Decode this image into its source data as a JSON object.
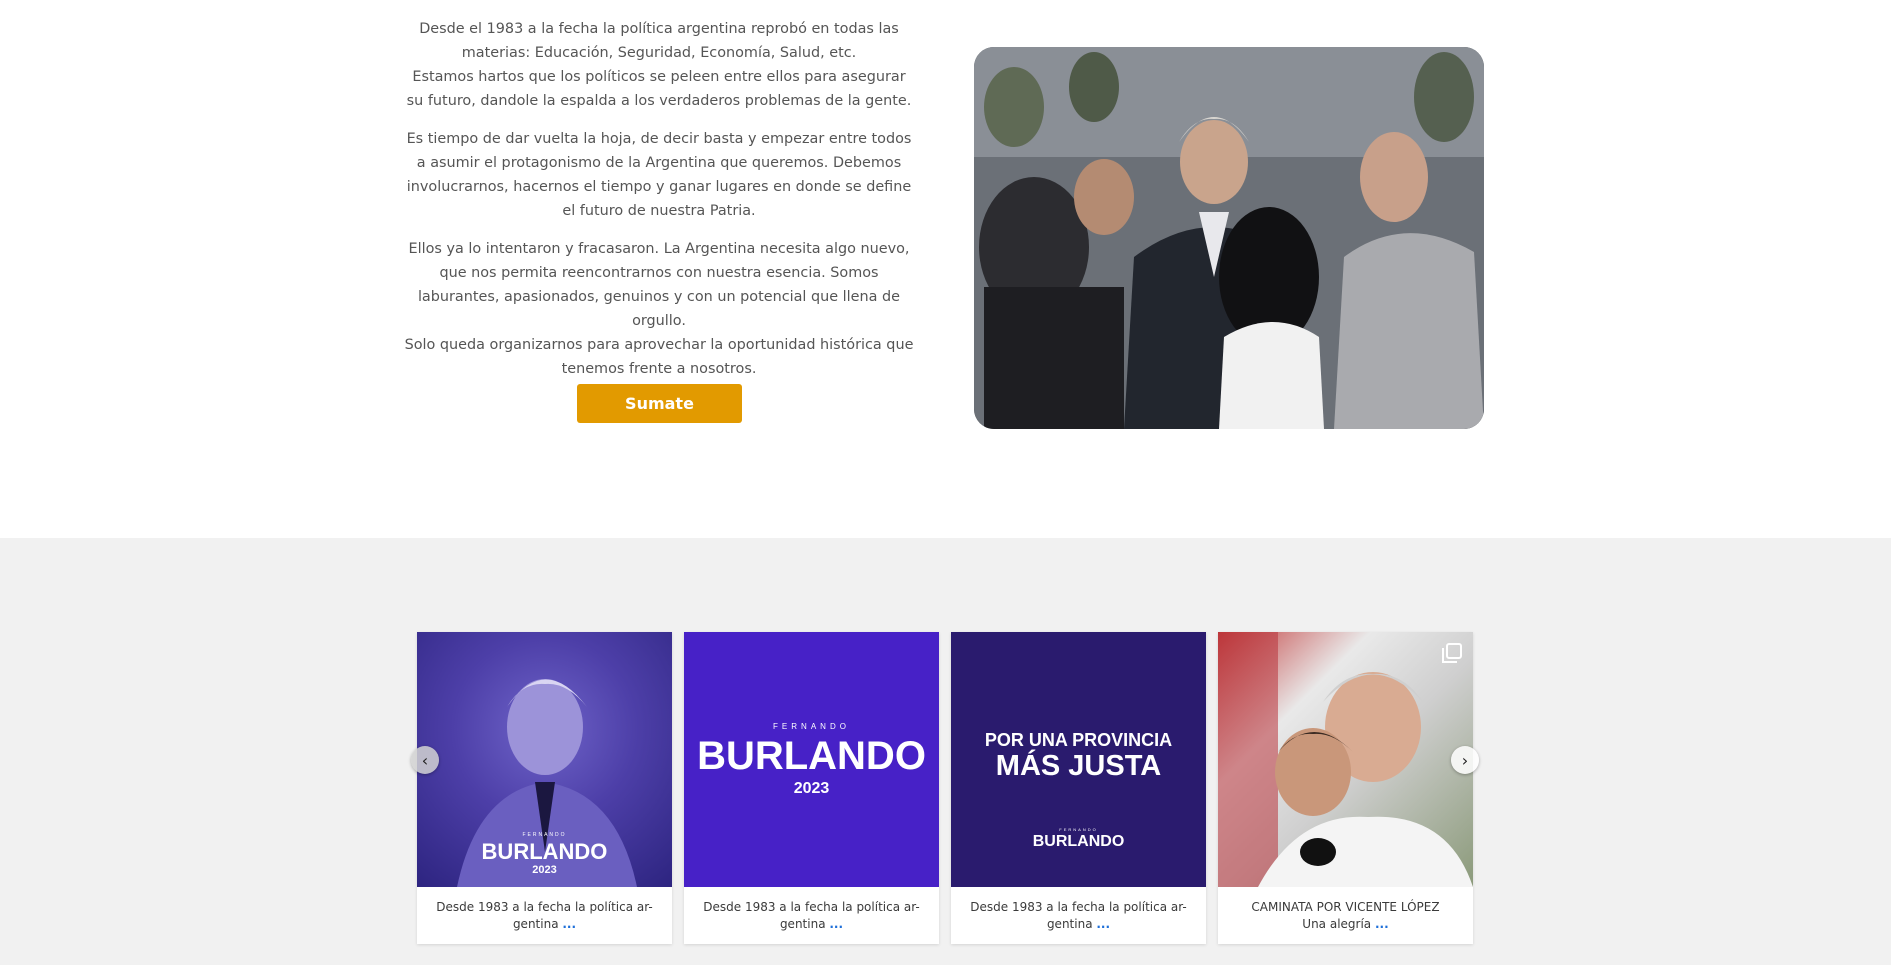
{
  "intro": {
    "paragraphs": [
      "Desde el 1983 a la fecha la política argentina reprobó en todas las materias: Educación, Seguridad, Economía, Salud, etc.\nEstamos hartos que los políticos se peleen entre ellos para asegurar su futuro, dandole la espalda a los verdaderos problemas de la gente.",
      "Es tiempo de dar vuelta la hoja, de decir basta y empezar entre todos a asumir el protagonismo de la Argentina que queremos. Debemos involucrarnos, hacernos el tiempo y ganar lugares en donde se define el futuro de nuestra Patria.",
      "Ellos ya lo intentaron y fracasaron. La Argentina necesita algo nuevo, que nos permita reencontrarnos con nuestra esencia. Somos laburantes, apasionados, genuinos y con un potencial que llena de orgullo.\nSolo queda organizarnos para aprovechar la oportunidad histórica que tenemos frente a nosotros."
    ],
    "cta_label": "Sumate"
  },
  "feed": {
    "posts": [
      {
        "caption": "Desde 1983 a la fecha la política ar-gentina",
        "more": "...",
        "brand_top": "FERNANDO",
        "brand": "BURLANDO",
        "year": "2023"
      },
      {
        "caption": "Desde 1983 a la fecha la política ar-gentina",
        "more": "...",
        "brand_top": "FERNANDO",
        "brand": "BURLANDO",
        "year": "2023"
      },
      {
        "caption": "Desde 1983 a la fecha la política ar-gentina",
        "more": "...",
        "headline_1": "POR UNA PROVINCIA",
        "headline_2": "MÁS JUSTA",
        "brand_top": "FERNANDO",
        "brand": "BURLANDO"
      },
      {
        "caption": "CAMINATA POR VICENTE LÓPEZ\nUna alegría",
        "more": "..."
      }
    ],
    "prev_icon": "chevron-left-icon",
    "next_icon": "chevron-right-icon"
  },
  "colors": {
    "cta": "#e29a00",
    "link": "#1e6fd9",
    "purple": "#4721c7"
  }
}
